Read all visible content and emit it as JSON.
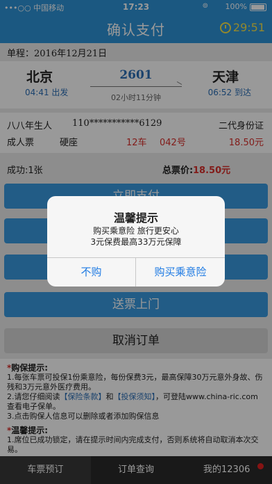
{
  "status_bar": {
    "carrier": "•••○○ 中国移动",
    "time": "17:23",
    "battery": "100%"
  },
  "nav": {
    "title": "确认支付",
    "countdown": "29:51"
  },
  "trip": {
    "date_label": "单程：2016年12月21日",
    "from": "北京",
    "to": "天津",
    "train_no": "2601",
    "depart": "04:41 出发",
    "arrive": "06:52 到达",
    "duration": "02小时11分钟"
  },
  "passenger": {
    "name": "八八年生人",
    "id_no": "110***********6129",
    "id_type": "二代身份证",
    "ticket_type": "成人票",
    "seat_type": "硬座",
    "car": "12车",
    "seat": "042号",
    "price": "18.50元"
  },
  "summary": {
    "success": "成功:1张",
    "total_label": "总票价:",
    "total_value": "18.50元"
  },
  "buttons": {
    "pay": "立即支付",
    "btn2": "",
    "btn3": "",
    "deliver": "送票上门",
    "cancel": "取消订单"
  },
  "tips": {
    "ins_title": "购保提示:",
    "ins_1": "1.每张车票可投保1份乘意险，每份保费3元，最高保障30万元意外身故、伤残和3万元意外医疗费用。",
    "ins_2a": "2.请您仔细阅读",
    "ins_2b": "【保险条款】",
    "ins_2c": "和",
    "ins_2d": "【投保须知】",
    "ins_2e": "，可登陆www.china-ric.com查看电子保单。",
    "ins_3": "3.点击购保人信息可以删除或者添加购保信息",
    "warm_title": "温馨提示:",
    "warm_1": "1.席位已成功锁定，请在提示时间内完成支付，否则系统将自动取消本次交易。"
  },
  "tabs": [
    "车票预订",
    "订单查询",
    "我的12306"
  ],
  "dialog": {
    "title": "温馨提示",
    "line1": "购买乘意险 旅行更安心",
    "line2": "3元保费最高33万元保障",
    "no": "不购",
    "yes": "购买乘意险"
  }
}
